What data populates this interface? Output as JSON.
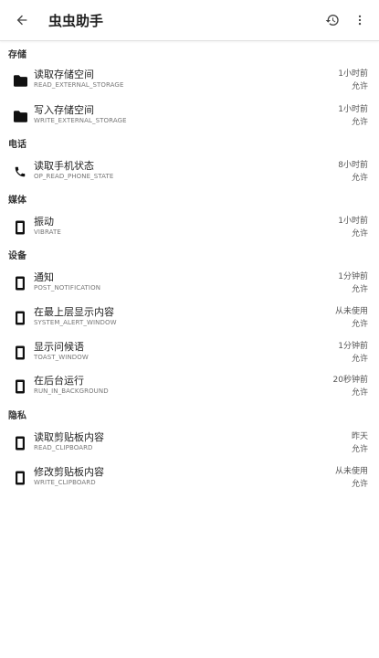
{
  "appbar": {
    "title": "虫虫助手",
    "back_icon": "arrow-back-icon",
    "history_icon": "history-icon",
    "more_icon": "more-vert-icon"
  },
  "sections": [
    {
      "header": "存储",
      "items": [
        {
          "title": "读取存储空间",
          "permission": "READ_EXTERNAL_STORAGE",
          "time": "1小时前",
          "status": "允许",
          "icon": "folder-icon"
        },
        {
          "title": "写入存储空间",
          "permission": "WRITE_EXTERNAL_STORAGE",
          "time": "1小时前",
          "status": "允许",
          "icon": "folder-icon"
        }
      ]
    },
    {
      "header": "电话",
      "items": [
        {
          "title": "读取手机状态",
          "permission": "OP_READ_PHONE_STATE",
          "time": "8小时前",
          "status": "允许",
          "icon": "phone-icon"
        }
      ]
    },
    {
      "header": "媒体",
      "items": [
        {
          "title": "振动",
          "permission": "VIBRATE",
          "time": "1小时前",
          "status": "允许",
          "icon": "device-icon"
        }
      ]
    },
    {
      "header": "设备",
      "items": [
        {
          "title": "通知",
          "permission": "POST_NOTIFICATION",
          "time": "1分钟前",
          "status": "允许",
          "icon": "device-icon"
        },
        {
          "title": "在最上层显示内容",
          "permission": "SYSTEM_ALERT_WINDOW",
          "time": "从未使用",
          "status": "允许",
          "icon": "device-icon"
        },
        {
          "title": "显示问候语",
          "permission": "TOAST_WINDOW",
          "time": "1分钟前",
          "status": "允许",
          "icon": "device-icon"
        },
        {
          "title": "在后台运行",
          "permission": "RUN_IN_BACKGROUND",
          "time": "20秒钟前",
          "status": "允许",
          "icon": "device-icon"
        }
      ]
    },
    {
      "header": "隐私",
      "items": [
        {
          "title": "读取剪贴板内容",
          "permission": "READ_CLIPBOARD",
          "time": "昨天",
          "status": "允许",
          "icon": "device-icon"
        },
        {
          "title": "修改剪贴板内容",
          "permission": "WRITE_CLIPBOARD",
          "time": "从未使用",
          "status": "允许",
          "icon": "device-icon"
        }
      ]
    }
  ]
}
